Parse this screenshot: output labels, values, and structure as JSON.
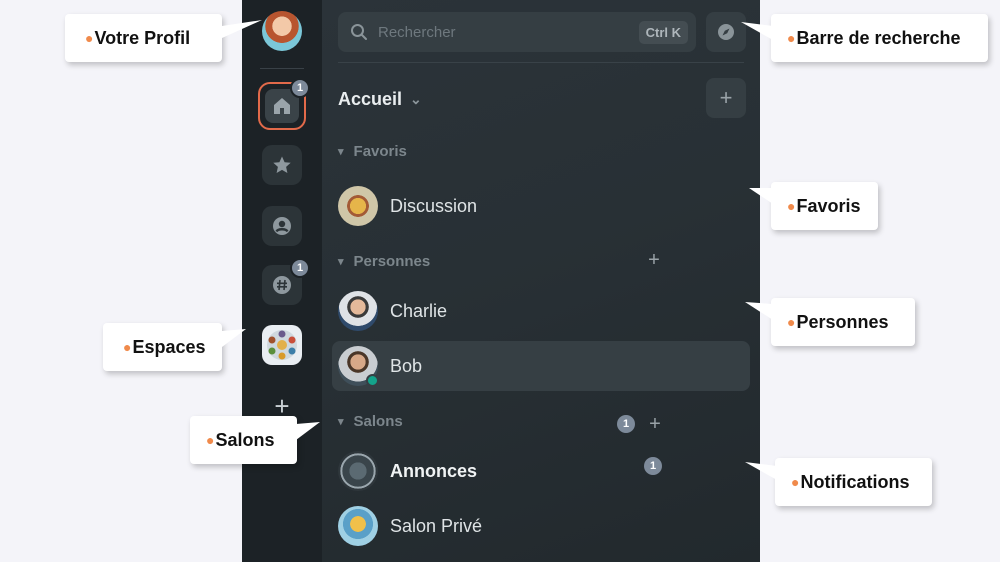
{
  "rail": {
    "home_badge": "1",
    "rooms_badge": "1",
    "add_space_label": "+"
  },
  "search": {
    "placeholder": "Rechercher",
    "shortcut": "Ctrl K"
  },
  "home": {
    "title": "Accueil",
    "add_label": "+"
  },
  "sections": {
    "favorites": {
      "title": "Favoris"
    },
    "people": {
      "title": "Personnes",
      "add_label": "+"
    },
    "rooms": {
      "title": "Salons",
      "count": "1",
      "add_label": "+"
    }
  },
  "favorites": [
    {
      "name": "Discussion"
    }
  ],
  "people": [
    {
      "name": "Charlie"
    },
    {
      "name": "Bob",
      "online": true
    }
  ],
  "rooms": [
    {
      "name": "Annonces",
      "unread": "1"
    },
    {
      "name": "Salon Privé"
    }
  ],
  "callouts": {
    "profile": "Votre Profil",
    "search": "Barre de recherche",
    "favorites": "Favoris",
    "spaces": "Espaces",
    "people": "Personnes",
    "rooms": "Salons",
    "notifications": "Notifications"
  },
  "colors": {
    "accent": "#e26a4a",
    "online": "#14a38b",
    "badge": "#7d8a9a",
    "callout_dot": "#f08a4b"
  }
}
